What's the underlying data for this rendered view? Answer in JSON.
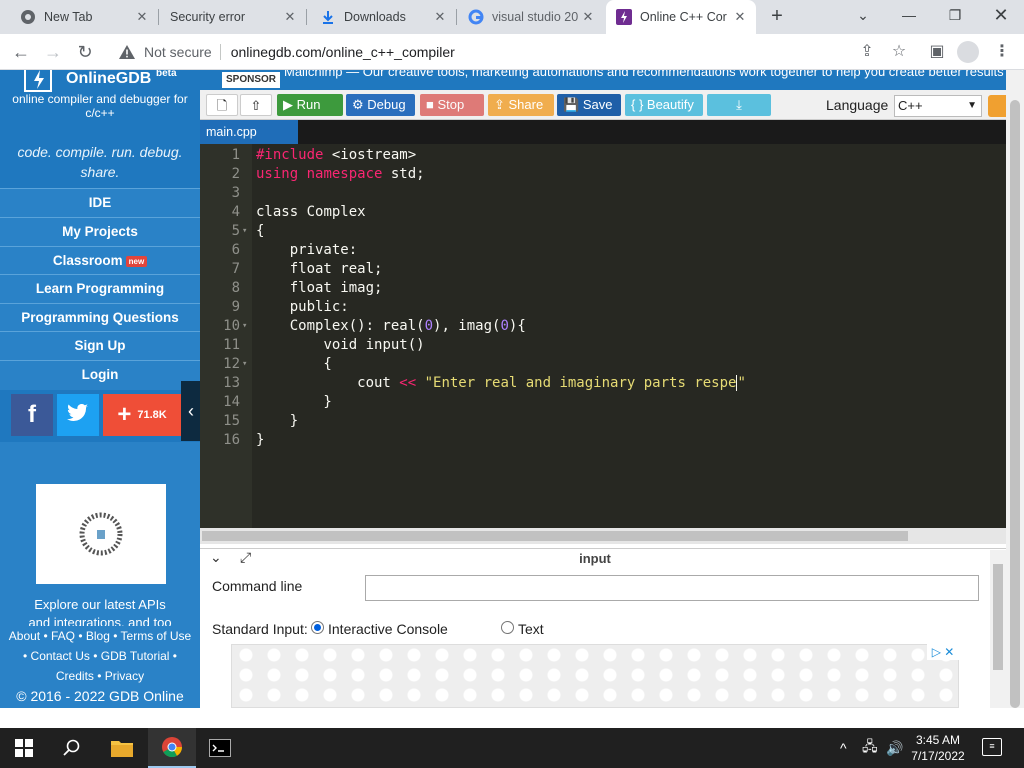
{
  "browser": {
    "tabs": [
      {
        "label": "New Tab",
        "icon": "chrome-icon"
      },
      {
        "label": "Security error",
        "icon": "blank-page-icon"
      },
      {
        "label": "Downloads",
        "icon": "download-icon"
      },
      {
        "label": "visual studio 20",
        "icon": "google-icon"
      },
      {
        "label": "Online C++ Cor",
        "icon": "onlinegdb-icon"
      }
    ],
    "not_secure": "Not secure",
    "url": "onlinegdb.com/online_c++_compiler"
  },
  "sidebar": {
    "brand": "OnlineGDB",
    "beta": "beta",
    "subtitle": "online compiler and debugger for c/c++",
    "tagline": "code. compile. run. debug. share.",
    "nav": [
      {
        "label": "IDE"
      },
      {
        "label": "My Projects"
      },
      {
        "label": "Classroom",
        "badge": "new"
      },
      {
        "label": "Learn Programming"
      },
      {
        "label": "Programming Questions"
      },
      {
        "label": "Sign Up"
      },
      {
        "label": "Login"
      }
    ],
    "share_count": "71.8K",
    "explore": "Explore our latest APIs",
    "explore_cut": "and integrations, and too",
    "footer_line1": "About • FAQ • Blog • Terms of Use",
    "footer_line2": "• Contact Us • GDB Tutorial •",
    "footer_line3": "Credits • Privacy",
    "copyright": "© 2016 - 2022 GDB Online"
  },
  "sponsor": {
    "tag": "SPONSOR",
    "text": "Mailchimp — Our creative tools, marketing automations and recommendations work together to help you create better results"
  },
  "toolbar": {
    "run": "Run",
    "debug": "Debug",
    "stop": "Stop",
    "share": "Share",
    "save": "Save",
    "beautify": "{ } Beautify",
    "language_label": "Language",
    "language_value": "C++"
  },
  "colors": {
    "run": "#3d9a3d",
    "debug": "#2a6ebd",
    "stop": "#d9534f",
    "share": "#f0ad4e",
    "save": "#1f5fa8",
    "beautify": "#5bc0de",
    "download": "#5bc0de",
    "facebook": "#3b5998",
    "twitter": "#1da1f2",
    "plus": "#ef4e37"
  },
  "editor": {
    "filename": "main.cpp",
    "lines": [
      "#include <iostream>",
      "using namespace std;",
      "",
      "class Complex",
      "{",
      "    private:",
      "    float real;",
      "    float imag;",
      "    public:",
      "    Complex(): real(0), imag(0){",
      "        void input()",
      "        {",
      "            cout << \"Enter real and imaginary parts respe\"",
      "        }",
      "    }",
      "}"
    ]
  },
  "io": {
    "title": "input",
    "cmdline_label": "Command line",
    "stdin_label": "Standard Input:",
    "opt_console": "Interactive Console",
    "opt_text": "Text"
  },
  "taskbar": {
    "time": "3:45 AM",
    "date": "7/17/2022"
  }
}
